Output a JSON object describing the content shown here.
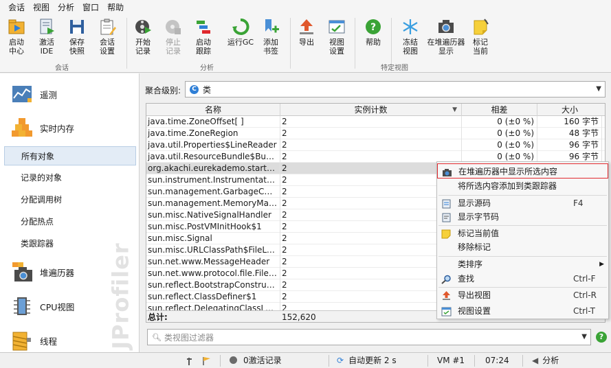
{
  "menu": [
    "会话",
    "视图",
    "分析",
    "窗口",
    "帮助"
  ],
  "toolbar": {
    "groups": [
      {
        "label": "会话",
        "buttons": [
          "启动\n中心",
          "激活\nIDE",
          "保存\n快照",
          "会话\n设置"
        ]
      },
      {
        "label": "分析",
        "buttons": [
          "开始\n记录",
          "停止\n记录",
          "启动\n跟踪",
          "运行GC",
          "添加\n书签"
        ]
      },
      {
        "label": "特定视图",
        "buttons": [
          "导出",
          "视图\n设置",
          "帮助",
          "冻结\n视图",
          "在堆遍历器\n显示",
          "标记\n当前"
        ]
      }
    ]
  },
  "nav": {
    "telemetry": "遥测",
    "live_memory": "实时内存",
    "all_objects": "所有对象",
    "recorded_objects": "记录的对象",
    "alloc_call_tree": "分配调用树",
    "alloc_hotspots": "分配热点",
    "class_tracker": "类跟踪器",
    "heap_walker": "堆遍历器",
    "cpu_views": "CPU视图",
    "threads": "线程",
    "watermark": "JProfiler"
  },
  "aggregation": {
    "label": "聚合级别:",
    "value": "类",
    "icon": "C"
  },
  "table": {
    "columns": [
      "名称",
      "实例计数",
      "相差",
      "大小"
    ],
    "rows": [
      [
        "java.time.ZoneOffset[ ]",
        "2",
        "0 (±0 %)",
        "160 字节"
      ],
      [
        "java.time.ZoneRegion",
        "2",
        "0 (±0 %)",
        "48 字节"
      ],
      [
        "java.util.Properties$LineReader",
        "2",
        "0 (±0 %)",
        "96 字节"
      ],
      [
        "java.util.ResourceBundle$BundleReference",
        "2",
        "0 (±0 %)",
        "96 字节"
      ],
      [
        "org.akachi.eurekademo.start.main",
        "2",
        "",
        ""
      ],
      [
        "sun.instrument.InstrumentationImpl",
        "2",
        "",
        ""
      ],
      [
        "sun.management.GarbageCollectorImpl",
        "2",
        "",
        ""
      ],
      [
        "sun.management.MemoryManagerImpl",
        "2",
        "",
        ""
      ],
      [
        "sun.misc.NativeSignalHandler",
        "2",
        "",
        ""
      ],
      [
        "sun.misc.PostVMInitHook$1",
        "2",
        "",
        ""
      ],
      [
        "sun.misc.Signal",
        "2",
        "",
        ""
      ],
      [
        "sun.misc.URLClassPath$FileLoader",
        "2",
        "",
        ""
      ],
      [
        "sun.net.www.MessageHeader",
        "2",
        "",
        ""
      ],
      [
        "sun.net.www.protocol.file.FileURLConnection",
        "2",
        "",
        ""
      ],
      [
        "sun.reflect.BootstrapConstructorAccessorImpl",
        "2",
        "",
        ""
      ],
      [
        "sun.reflect.ClassDefiner$1",
        "2",
        "",
        ""
      ],
      [
        "sun.reflect.DelegatingClassLoader",
        "2",
        "",
        ""
      ]
    ],
    "footer": {
      "label": "总计:",
      "count": "152,620"
    }
  },
  "filter": {
    "placeholder": "类视图过滤器"
  },
  "context_menu": {
    "show_in_heap_walker": "在堆遍历器中显示所选内容",
    "add_to_tracker": "将所选内容添加到类跟踪器",
    "show_source": "显示源码",
    "show_source_shortcut": "F4",
    "show_bytecode": "显示字节码",
    "mark_current": "标记当前值",
    "remove_mark": "移除标记",
    "sort": "类排序",
    "find": "查找",
    "find_shortcut": "Ctrl-F",
    "export_view": "导出视图",
    "export_shortcut": "Ctrl-R",
    "view_settings": "视图设置",
    "view_settings_shortcut": "Ctrl-T"
  },
  "status": {
    "recordings": "0激活记录",
    "auto_update": "自动更新 2 s",
    "vm": "VM #1",
    "time": "07:24",
    "mode": "分析"
  },
  "colors": {
    "accent": "#2f7fd6",
    "highlight": "#e0282d",
    "selected_row": "#dcdcdc"
  }
}
